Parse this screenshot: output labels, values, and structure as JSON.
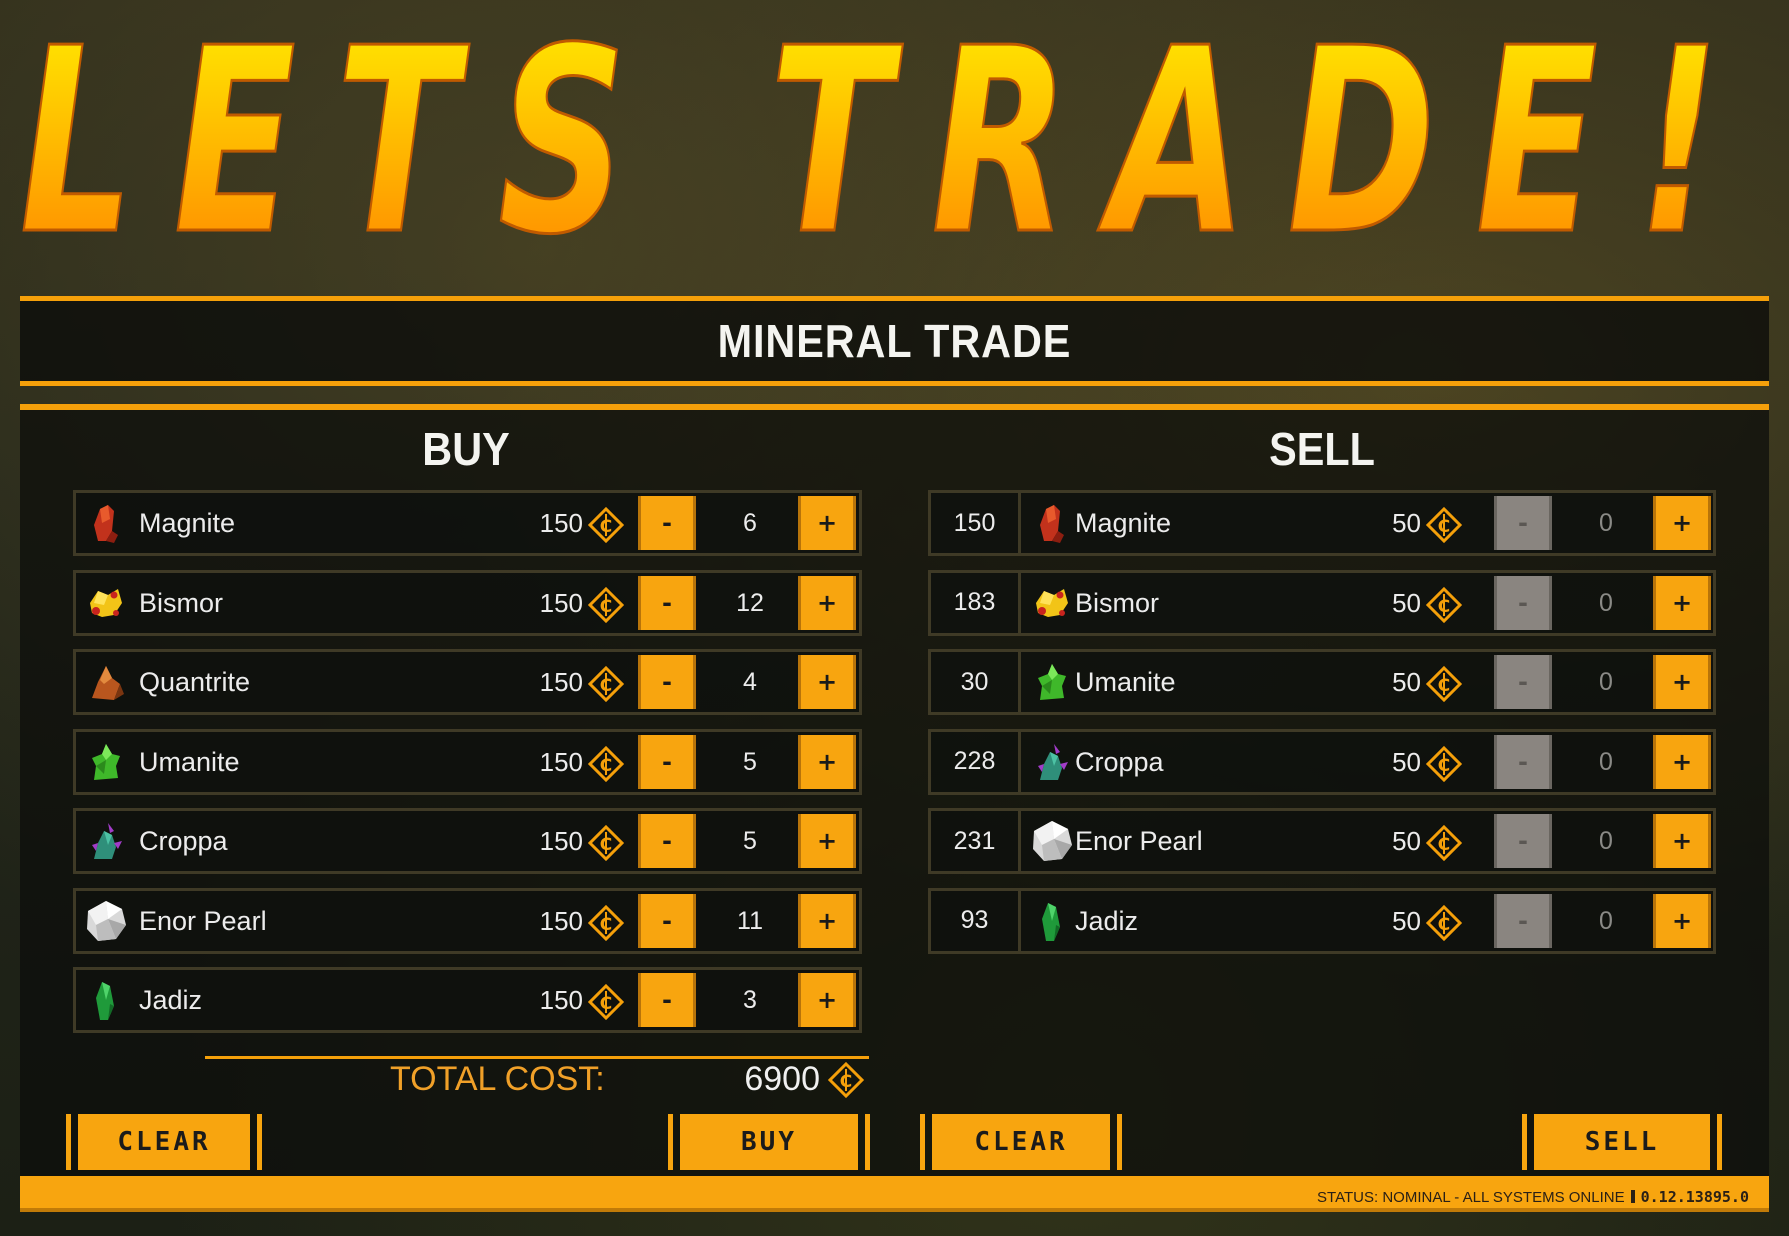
{
  "headline": "LETS TRADE!",
  "title": "MINERAL TRADE",
  "colors": {
    "accent": "#f8a50f",
    "headline_top": "#fff200",
    "headline_bottom": "#ff8a00",
    "disabled": "#8a8580"
  },
  "buy": {
    "heading": "BUY",
    "items": [
      {
        "name": "Magnite",
        "price": "150",
        "qty": "6",
        "icon": "magnite-icon"
      },
      {
        "name": "Bismor",
        "price": "150",
        "qty": "12",
        "icon": "bismor-icon"
      },
      {
        "name": "Quantrite",
        "price": "150",
        "qty": "4",
        "icon": "quantrite-icon"
      },
      {
        "name": "Umanite",
        "price": "150",
        "qty": "5",
        "icon": "umanite-icon"
      },
      {
        "name": "Croppa",
        "price": "150",
        "qty": "5",
        "icon": "croppa-icon"
      },
      {
        "name": "Enor Pearl",
        "price": "150",
        "qty": "11",
        "icon": "enor-pearl-icon"
      },
      {
        "name": "Jadiz",
        "price": "150",
        "qty": "3",
        "icon": "jadiz-icon"
      }
    ],
    "minus_label": "-",
    "plus_label": "+",
    "total_label": "TOTAL COST:",
    "total_value": "6900",
    "clear_label": "CLEAR",
    "action_label": "BUY"
  },
  "sell": {
    "heading": "SELL",
    "items": [
      {
        "stock": "150",
        "name": "Magnite",
        "price": "50",
        "qty": "0",
        "icon": "magnite-icon"
      },
      {
        "stock": "183",
        "name": "Bismor",
        "price": "50",
        "qty": "0",
        "icon": "bismor-icon"
      },
      {
        "stock": "30",
        "name": "Umanite",
        "price": "50",
        "qty": "0",
        "icon": "umanite-icon"
      },
      {
        "stock": "228",
        "name": "Croppa",
        "price": "50",
        "qty": "0",
        "icon": "croppa-icon"
      },
      {
        "stock": "231",
        "name": "Enor Pearl",
        "price": "50",
        "qty": "0",
        "icon": "enor-pearl-icon"
      },
      {
        "stock": "93",
        "name": "Jadiz",
        "price": "50",
        "qty": "0",
        "icon": "jadiz-icon"
      }
    ],
    "minus_label": "-",
    "plus_label": "+",
    "clear_label": "CLEAR",
    "action_label": "SELL"
  },
  "status": {
    "text": "STATUS: NOMINAL - ALL SYSTEMS ONLINE",
    "version": "0.12.13895.0"
  }
}
